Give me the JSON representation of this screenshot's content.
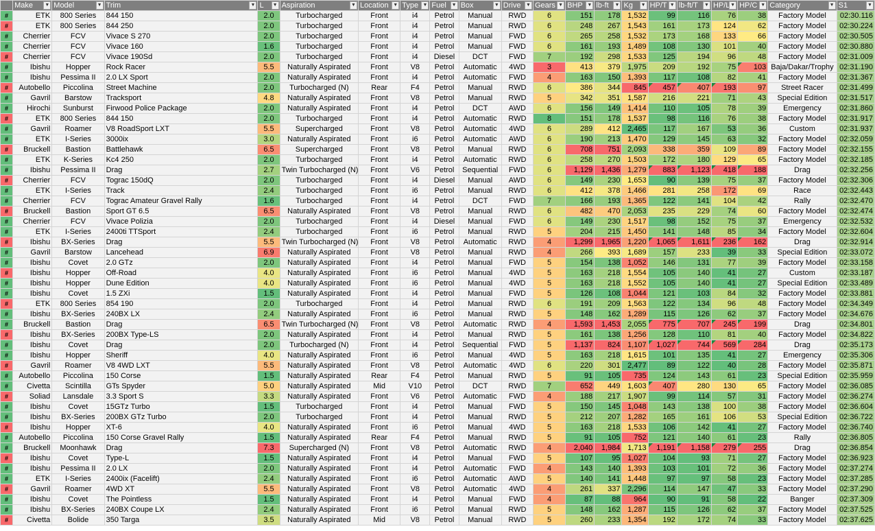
{
  "sheet": {
    "headers": [
      "Make",
      "Model",
      "Trim",
      "L",
      "Aspiration",
      "Location",
      "Type",
      "Fuel",
      "Box",
      "Drive",
      "Gears",
      "BHP",
      "lb-ft",
      "Kg",
      "HP/T",
      "lb-ft/T",
      "HP/L",
      "HP/C",
      "Category",
      "S1"
    ],
    "colors": {
      "header_bg": "#7f7f7f",
      "green": "#63be7b",
      "yellow": "#ffeb84",
      "red": "#f8696b",
      "s1_green": "#a9d18e"
    },
    "rows": [
      [
        "ETK",
        "800 Series",
        "844 150",
        "2.0",
        "Turbocharged",
        "Front",
        "i4",
        "Petrol",
        "Manual",
        "RWD",
        "6",
        "151",
        "178",
        "1,532",
        "99",
        "116",
        "76",
        "38",
        "Factory Model",
        "02:30.116"
      ],
      [
        "ETK",
        "800 Series",
        "844 250",
        "2.0",
        "Turbocharged",
        "Front",
        "i4",
        "Petrol",
        "Manual",
        "RWD",
        "6",
        "248",
        "267",
        "1,543",
        "161",
        "173",
        "124",
        "62",
        "Factory Model",
        "02:30.224"
      ],
      [
        "Cherrier",
        "FCV",
        "Vivace S 270",
        "2.0",
        "Turbocharged",
        "Front",
        "i4",
        "Petrol",
        "Manual",
        "FWD",
        "6",
        "265",
        "258",
        "1,532",
        "173",
        "168",
        "133",
        "66",
        "Factory Model",
        "02:30.505"
      ],
      [
        "Cherrier",
        "FCV",
        "Vivace 160",
        "1.6",
        "Turbocharged",
        "Front",
        "i4",
        "Petrol",
        "Manual",
        "FWD",
        "6",
        "161",
        "193",
        "1,489",
        "108",
        "130",
        "101",
        "40",
        "Factory Model",
        "02:30.880"
      ],
      [
        "Cherrier",
        "FCV",
        "Vivace 190Sd",
        "2.0",
        "Turbocharged",
        "Front",
        "i4",
        "Diesel",
        "DCT",
        "FWD",
        "7",
        "192",
        "298",
        "1,533",
        "125",
        "194",
        "96",
        "48",
        "Factory Model",
        "02:31.009"
      ],
      [
        "Ibishu",
        "Hopper",
        "Rock Racer",
        "5.5",
        "Naturally Aspirated",
        "Front",
        "V8",
        "Petrol",
        "Automatic",
        "4WD",
        "3",
        "413",
        "379",
        "1,975",
        "209",
        "192",
        "75",
        "103",
        "Baja/Dakar/Trophy",
        "02:31.190"
      ],
      [
        "Ibishu",
        "Pessima II",
        "2.0 LX Sport",
        "2.0",
        "Naturally Aspirated",
        "Front",
        "i4",
        "Petrol",
        "Automatic",
        "FWD",
        "4",
        "163",
        "150",
        "1,393",
        "117",
        "108",
        "82",
        "41",
        "Factory Model",
        "02:31.367"
      ],
      [
        "Autobello",
        "Piccolina",
        "Street Machine",
        "2.0",
        "Turbocharged (N)",
        "Rear",
        "F4",
        "Petrol",
        "Manual",
        "RWD",
        "6",
        "386",
        "344",
        "845",
        "457",
        "407",
        "193",
        "97",
        "Street Racer",
        "02:31.499"
      ],
      [
        "Gavril",
        "Barstow",
        "Tracksport",
        "4.8",
        "Naturally Aspirated",
        "Front",
        "V8",
        "Petrol",
        "Manual",
        "RWD",
        "5",
        "342",
        "351",
        "1,587",
        "216",
        "221",
        "71",
        "43",
        "Special Edition",
        "02:31.517"
      ],
      [
        "Hirochi",
        "Sunburst",
        "Firwood Police Package",
        "2.0",
        "Naturally Aspirated",
        "Front",
        "i4",
        "Petrol",
        "DCT",
        "AWD",
        "6",
        "156",
        "149",
        "1,414",
        "110",
        "105",
        "78",
        "39",
        "Emergency",
        "02:31.860"
      ],
      [
        "ETK",
        "800 Series",
        "844 150",
        "2.0",
        "Turbocharged",
        "Front",
        "i4",
        "Petrol",
        "Automatic",
        "RWD",
        "8",
        "151",
        "178",
        "1,537",
        "98",
        "116",
        "76",
        "38",
        "Factory Model",
        "02:31.917"
      ],
      [
        "Gavril",
        "Roamer",
        "V8 RoadSport LXT",
        "5.5",
        "Supercharged",
        "Front",
        "V8",
        "Petrol",
        "Automatic",
        "4WD",
        "6",
        "289",
        "412",
        "2,465",
        "117",
        "167",
        "53",
        "36",
        "Custom",
        "02:31.937"
      ],
      [
        "ETK",
        "I-Series",
        "3000ix",
        "3.0",
        "Naturally Aspirated",
        "Front",
        "i6",
        "Petrol",
        "Automatic",
        "AWD",
        "6",
        "190",
        "213",
        "1,470",
        "129",
        "145",
        "63",
        "32",
        "Factory Model",
        "02:32.059"
      ],
      [
        "Bruckell",
        "Bastion",
        "Battlehawk",
        "6.5",
        "Supercharged",
        "Front",
        "V8",
        "Petrol",
        "Manual",
        "RWD",
        "6",
        "708",
        "751",
        "2,093",
        "338",
        "359",
        "109",
        "89",
        "Factory Model",
        "02:32.155"
      ],
      [
        "ETK",
        "K-Series",
        "Kc4 250",
        "2.0",
        "Turbocharged",
        "Front",
        "i4",
        "Petrol",
        "Automatic",
        "RWD",
        "6",
        "258",
        "270",
        "1,503",
        "172",
        "180",
        "129",
        "65",
        "Factory Model",
        "02:32.185"
      ],
      [
        "Ibishu",
        "Pessima II",
        "Drag",
        "2.7",
        "Twin Turbocharged (N)",
        "Front",
        "V6",
        "Petrol",
        "Sequential",
        "FWD",
        "6",
        "1,129",
        "1,436",
        "1,279",
        "883",
        "1,123",
        "418",
        "188",
        "Drag",
        "02:32.256"
      ],
      [
        "Cherrier",
        "FCV",
        "Tograc 150dQ",
        "2.0",
        "Turbocharged",
        "Front",
        "i4",
        "Diesel",
        "Manual",
        "AWD",
        "6",
        "149",
        "230",
        "1,653",
        "90",
        "139",
        "75",
        "37",
        "Factory Model",
        "02:32.306"
      ],
      [
        "ETK",
        "I-Series",
        "Track",
        "2.4",
        "Turbocharged",
        "Front",
        "i6",
        "Petrol",
        "Manual",
        "RWD",
        "6",
        "412",
        "378",
        "1,466",
        "281",
        "258",
        "172",
        "69",
        "Race",
        "02:32.443"
      ],
      [
        "Cherrier",
        "FCV",
        "Tograc Amateur Gravel Rally",
        "1.6",
        "Turbocharged",
        "Front",
        "i4",
        "Petrol",
        "DCT",
        "FWD",
        "7",
        "166",
        "193",
        "1,365",
        "122",
        "141",
        "104",
        "42",
        "Rally",
        "02:32.470"
      ],
      [
        "Bruckell",
        "Bastion",
        "Sport GT 6.5",
        "6.5",
        "Naturally Aspirated",
        "Front",
        "V8",
        "Petrol",
        "Manual",
        "RWD",
        "6",
        "482",
        "470",
        "2,053",
        "235",
        "229",
        "74",
        "60",
        "Factory Model",
        "02:32.474"
      ],
      [
        "Cherrier",
        "FCV",
        "Vivace Polizia",
        "2.0",
        "Turbocharged",
        "Front",
        "i4",
        "Diesel",
        "Manual",
        "FWD",
        "6",
        "149",
        "230",
        "1,517",
        "98",
        "152",
        "75",
        "37",
        "Emergency",
        "02:32.532"
      ],
      [
        "ETK",
        "I-Series",
        "2400ti TTSport",
        "2.4",
        "Turbocharged",
        "Front",
        "i6",
        "Petrol",
        "Manual",
        "RWD",
        "5",
        "204",
        "215",
        "1,450",
        "141",
        "148",
        "85",
        "34",
        "Factory Model",
        "02:32.604"
      ],
      [
        "Ibishu",
        "BX-Series",
        "Drag",
        "5.5",
        "Twin Turbocharged (N)",
        "Front",
        "V8",
        "Petrol",
        "Automatic",
        "RWD",
        "4",
        "1,299",
        "1,965",
        "1,220",
        "1,065",
        "1,611",
        "236",
        "162",
        "Drag",
        "02:32.914"
      ],
      [
        "Gavril",
        "Barstow",
        "Lancehead",
        "6.9",
        "Naturally Aspirated",
        "Front",
        "V8",
        "Petrol",
        "Manual",
        "RWD",
        "4",
        "266",
        "393",
        "1,689",
        "157",
        "233",
        "39",
        "33",
        "Special Edition",
        "02:33.072"
      ],
      [
        "Ibishu",
        "Covet",
        "2.0 GTz",
        "2.0",
        "Naturally Aspirated",
        "Front",
        "i4",
        "Petrol",
        "Manual",
        "FWD",
        "5",
        "154",
        "138",
        "1,052",
        "146",
        "131",
        "77",
        "39",
        "Factory Model",
        "02:33.158"
      ],
      [
        "Ibishu",
        "Hopper",
        "Off-Road",
        "4.0",
        "Naturally Aspirated",
        "Front",
        "i6",
        "Petrol",
        "Manual",
        "4WD",
        "5",
        "163",
        "218",
        "1,554",
        "105",
        "140",
        "41",
        "27",
        "Custom",
        "02:33.187"
      ],
      [
        "Ibishu",
        "Hopper",
        "Dune Edition",
        "4.0",
        "Naturally Aspirated",
        "Front",
        "i6",
        "Petrol",
        "Manual",
        "4WD",
        "5",
        "163",
        "218",
        "1,552",
        "105",
        "140",
        "41",
        "27",
        "Special Edition",
        "02:33.489"
      ],
      [
        "Ibishu",
        "Covet",
        "1.5 ZXi",
        "1.5",
        "Naturally Aspirated",
        "Front",
        "i4",
        "Petrol",
        "Manual",
        "FWD",
        "5",
        "126",
        "108",
        "1,044",
        "121",
        "103",
        "84",
        "32",
        "Factory Model",
        "02:33.881"
      ],
      [
        "ETK",
        "800 Series",
        "854 190",
        "2.0",
        "Turbocharged",
        "Front",
        "i4",
        "Petrol",
        "Manual",
        "RWD",
        "6",
        "191",
        "209",
        "1,563",
        "122",
        "134",
        "96",
        "48",
        "Factory Model",
        "02:34.349"
      ],
      [
        "Ibishu",
        "BX-Series",
        "240BX LX",
        "2.4",
        "Naturally Aspirated",
        "Front",
        "i6",
        "Petrol",
        "Manual",
        "RWD",
        "5",
        "148",
        "162",
        "1,289",
        "115",
        "126",
        "62",
        "37",
        "Factory Model",
        "02:34.676"
      ],
      [
        "Bruckell",
        "Bastion",
        "Drag",
        "6.5",
        "Twin Turbocharged (N)",
        "Front",
        "V8",
        "Petrol",
        "Automatic",
        "RWD",
        "4",
        "1,593",
        "1,453",
        "2,055",
        "775",
        "707",
        "245",
        "199",
        "Drag",
        "02:34.801"
      ],
      [
        "Ibishu",
        "BX-Series",
        "200BX Type-LS",
        "2.0",
        "Naturally Aspirated",
        "Front",
        "i4",
        "Petrol",
        "Manual",
        "RWD",
        "5",
        "161",
        "138",
        "1,256",
        "128",
        "110",
        "81",
        "40",
        "Factory Model",
        "02:34.822"
      ],
      [
        "Ibishu",
        "Covet",
        "Drag",
        "2.0",
        "Turbocharged (N)",
        "Front",
        "i4",
        "Petrol",
        "Sequential",
        "FWD",
        "5",
        "1,137",
        "824",
        "1,107",
        "1,027",
        "744",
        "569",
        "284",
        "Drag",
        "02:35.173"
      ],
      [
        "Ibishu",
        "Hopper",
        "Sheriff",
        "4.0",
        "Naturally Aspirated",
        "Front",
        "i6",
        "Petrol",
        "Manual",
        "4WD",
        "5",
        "163",
        "218",
        "1,615",
        "101",
        "135",
        "41",
        "27",
        "Emergency",
        "02:35.306"
      ],
      [
        "Gavril",
        "Roamer",
        "V8 4WD LXT",
        "5.5",
        "Naturally Aspirated",
        "Front",
        "V8",
        "Petrol",
        "Automatic",
        "4WD",
        "6",
        "220",
        "301",
        "2,477",
        "89",
        "122",
        "40",
        "28",
        "Factory Model",
        "02:35.871"
      ],
      [
        "Autobello",
        "Piccolina",
        "150 Corse",
        "1.5",
        "Naturally Aspirated",
        "Rear",
        "F4",
        "Petrol",
        "Manual",
        "RWD",
        "5",
        "91",
        "105",
        "735",
        "124",
        "143",
        "61",
        "23",
        "Special Edition",
        "02:35.959"
      ],
      [
        "Civetta",
        "Scintilla",
        "GTs Spyder",
        "5.0",
        "Naturally Aspirated",
        "Mid",
        "V10",
        "Petrol",
        "DCT",
        "RWD",
        "7",
        "652",
        "449",
        "1,603",
        "407",
        "280",
        "130",
        "65",
        "Factory Model",
        "02:36.085"
      ],
      [
        "Soliad",
        "Lansdale",
        "3.3 Sport S",
        "3.3",
        "Naturally Aspirated",
        "Front",
        "V6",
        "Petrol",
        "Automatic",
        "FWD",
        "4",
        "188",
        "217",
        "1,907",
        "99",
        "114",
        "57",
        "31",
        "Factory Model",
        "02:36.274"
      ],
      [
        "Ibishu",
        "Covet",
        "15GTz Turbo",
        "1.5",
        "Turbocharged",
        "Front",
        "i4",
        "Petrol",
        "Manual",
        "FWD",
        "5",
        "150",
        "145",
        "1,048",
        "143",
        "138",
        "100",
        "38",
        "Factory Model",
        "02:36.604"
      ],
      [
        "Ibishu",
        "BX-Series",
        "200BX GTz Turbo",
        "2.0",
        "Turbocharged",
        "Front",
        "i4",
        "Petrol",
        "Manual",
        "RWD",
        "5",
        "212",
        "207",
        "1,282",
        "165",
        "161",
        "106",
        "53",
        "Special Edition",
        "02:36.722"
      ],
      [
        "Ibishu",
        "Hopper",
        "XT-6",
        "4.0",
        "Naturally Aspirated",
        "Front",
        "i6",
        "Petrol",
        "Manual",
        "4WD",
        "5",
        "163",
        "218",
        "1,533",
        "106",
        "142",
        "41",
        "27",
        "Factory Model",
        "02:36.740"
      ],
      [
        "Autobello",
        "Piccolina",
        "150 Corse Gravel Rally",
        "1.5",
        "Naturally Aspirated",
        "Rear",
        "F4",
        "Petrol",
        "Manual",
        "RWD",
        "5",
        "91",
        "105",
        "752",
        "121",
        "140",
        "61",
        "23",
        "Rally",
        "02:36.805"
      ],
      [
        "Bruckell",
        "Moonhawk",
        "Drag",
        "7.3",
        "Supercharged (N)",
        "Front",
        "V8",
        "Petrol",
        "Automatic",
        "RWD",
        "4",
        "2,040",
        "1,984",
        "1,713",
        "1,191",
        "1,158",
        "279",
        "255",
        "Drag",
        "02:36.854"
      ],
      [
        "Ibishu",
        "Covet",
        "Type-L",
        "1.5",
        "Naturally Aspirated",
        "Front",
        "i4",
        "Petrol",
        "Manual",
        "FWD",
        "5",
        "107",
        "95",
        "1,027",
        "104",
        "93",
        "71",
        "27",
        "Factory Model",
        "02:36.923"
      ],
      [
        "Ibishu",
        "Pessima II",
        "2.0 LX",
        "2.0",
        "Naturally Aspirated",
        "Front",
        "i4",
        "Petrol",
        "Automatic",
        "FWD",
        "4",
        "143",
        "140",
        "1,393",
        "103",
        "101",
        "72",
        "36",
        "Factory Model",
        "02:37.274"
      ],
      [
        "ETK",
        "I-Series",
        "2400ix (Facelift)",
        "2.4",
        "Naturally Aspirated",
        "Front",
        "i6",
        "Petrol",
        "Automatic",
        "AWD",
        "5",
        "140",
        "141",
        "1,448",
        "97",
        "97",
        "58",
        "23",
        "Factory Model",
        "02:37.285"
      ],
      [
        "Gavril",
        "Roamer",
        "4WD XT",
        "5.5",
        "Naturally Aspirated",
        "Front",
        "V8",
        "Petrol",
        "Automatic",
        "4WD",
        "4",
        "261",
        "337",
        "2,296",
        "114",
        "147",
        "47",
        "33",
        "Factory Model",
        "02:37.290"
      ],
      [
        "Ibishu",
        "Covet",
        "The Pointless",
        "1.5",
        "Naturally Aspirated",
        "Front",
        "i4",
        "Petrol",
        "Manual",
        "FWD",
        "4",
        "87",
        "88",
        "964",
        "90",
        "91",
        "58",
        "22",
        "Banger",
        "02:37.309"
      ],
      [
        "Ibishu",
        "BX-Series",
        "240BX Coupe LX",
        "2.4",
        "Naturally Aspirated",
        "Front",
        "i6",
        "Petrol",
        "Manual",
        "RWD",
        "5",
        "148",
        "162",
        "1,287",
        "115",
        "126",
        "62",
        "37",
        "Factory Model",
        "02:37.525"
      ],
      [
        "Civetta",
        "Bolide",
        "350 Targa",
        "3.5",
        "Naturally Aspirated",
        "Mid",
        "V8",
        "Petrol",
        "Manual",
        "RWD",
        "5",
        "260",
        "233",
        "1,354",
        "192",
        "172",
        "74",
        "33",
        "Factory Model",
        "02:37.625"
      ]
    ]
  }
}
